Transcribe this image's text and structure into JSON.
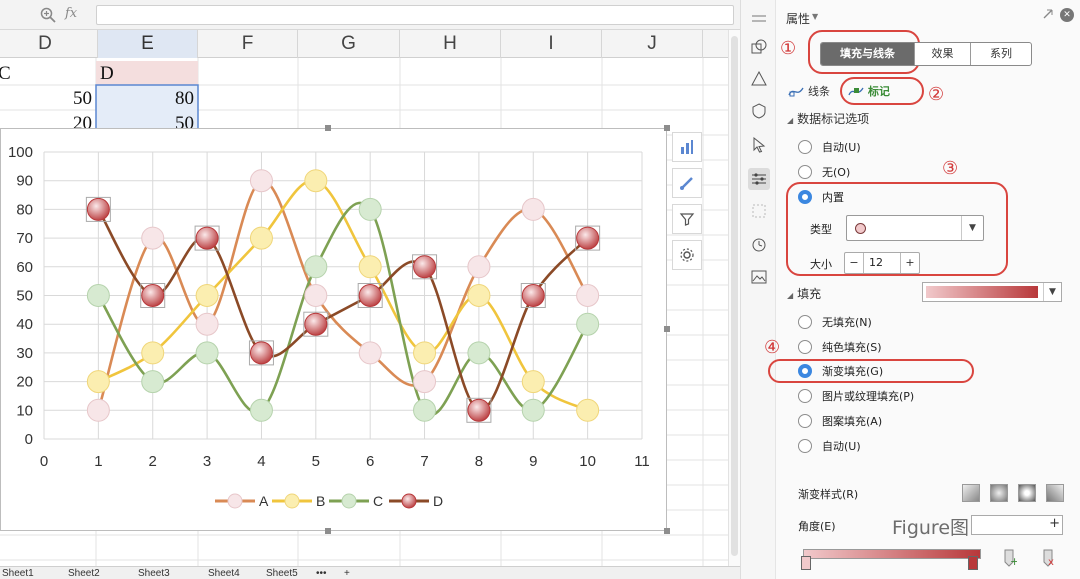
{
  "formula_bar": {
    "fx_label": "fx"
  },
  "columns": [
    "D",
    "E",
    "F",
    "G",
    "H",
    "I",
    "J"
  ],
  "cells": {
    "c_header": "C",
    "d_header": "D",
    "row2": [
      "50",
      "80"
    ],
    "row3": [
      "20",
      "50"
    ]
  },
  "sheet_tabs": [
    "Sheet1",
    "Sheet2",
    "Sheet3",
    "Sheet4",
    "Sheet5",
    "•••",
    "+"
  ],
  "colors": {
    "A": "#d98a55",
    "B": "#f0c53d",
    "C": "#7ea153",
    "D": "#8b4a27",
    "marker_fill": "#f1c9cb",
    "marker_edge": "#b8383a",
    "accent": "#d9453f"
  },
  "chart_data": {
    "type": "scatter",
    "subtype": "smooth-lines-with-markers",
    "x": [
      1,
      2,
      3,
      4,
      5,
      6,
      7,
      8,
      9,
      10
    ],
    "series": [
      {
        "name": "A",
        "values": [
          10,
          70,
          40,
          90,
          50,
          30,
          20,
          60,
          80,
          50
        ]
      },
      {
        "name": "B",
        "values": [
          20,
          30,
          50,
          70,
          90,
          60,
          30,
          50,
          20,
          10
        ]
      },
      {
        "name": "C",
        "values": [
          50,
          20,
          30,
          10,
          60,
          80,
          10,
          30,
          10,
          40
        ]
      },
      {
        "name": "D",
        "values": [
          80,
          50,
          70,
          30,
          40,
          50,
          60,
          10,
          50,
          70
        ]
      }
    ],
    "xlim": [
      0,
      11
    ],
    "ylim": [
      0,
      100
    ],
    "xticks": [
      "0",
      "1",
      "2",
      "3",
      "4",
      "5",
      "6",
      "7",
      "8",
      "9",
      "10",
      "11"
    ],
    "yticks": [
      "0",
      "10",
      "20",
      "30",
      "40",
      "50",
      "60",
      "70",
      "80",
      "90",
      "100"
    ],
    "grid": true,
    "legend": "bottom",
    "title": "",
    "xlabel": "",
    "ylabel": ""
  },
  "panel": {
    "title": "属性",
    "tabs": [
      "填充与线条",
      "效果",
      "系列"
    ],
    "sub_tabs": [
      "线条",
      "标记"
    ],
    "marker_section": "数据标记选项",
    "marker_options": [
      "自动(U)",
      "无(O)",
      "内置"
    ],
    "type_label": "类型",
    "size_label": "大小",
    "size_value": "12",
    "size_minus": "−",
    "size_plus": "+",
    "fill_section": "填充",
    "fill_options": [
      "无填充(N)",
      "纯色填充(S)",
      "渐变填充(G)",
      "图片或纹理填充(P)",
      "图案填充(A)",
      "自动(U)"
    ],
    "gradient_style_label": "渐变样式(R)",
    "angle_label": "角度(E)",
    "angle_plus": "+",
    "annotations": [
      "①",
      "②",
      "③",
      "④"
    ]
  },
  "watermark": "Figure图"
}
